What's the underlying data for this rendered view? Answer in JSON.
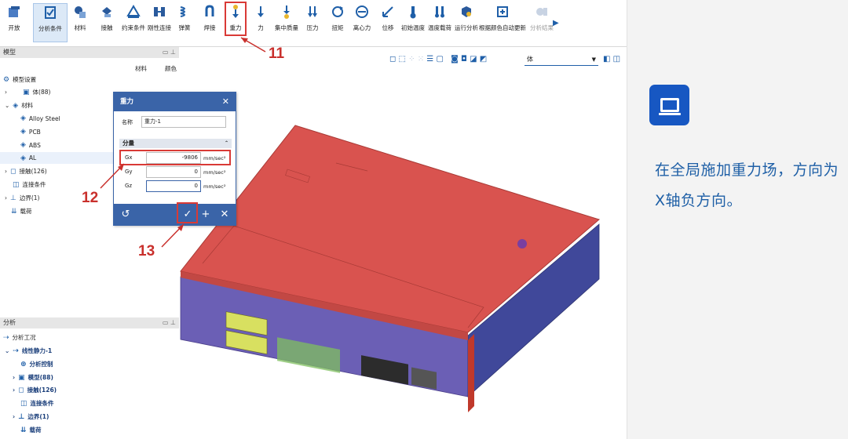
{
  "ribbon": {
    "items": [
      {
        "label": "开放",
        "icon": "open-icon"
      },
      {
        "label": "分析条件",
        "icon": "analysis-conditions-icon"
      },
      {
        "label": "材料",
        "icon": "material-icon"
      },
      {
        "label": "接触",
        "icon": "contact-icon"
      },
      {
        "label": "约束条件",
        "icon": "constraint-icon"
      },
      {
        "label": "刚性连接",
        "icon": "rigid-link-icon"
      },
      {
        "label": "弹簧",
        "icon": "spring-icon"
      },
      {
        "label": "焊接",
        "icon": "weld-icon"
      },
      {
        "label": "重力",
        "icon": "gravity-icon"
      },
      {
        "label": "力",
        "icon": "force-icon"
      },
      {
        "label": "集中质量",
        "icon": "point-mass-icon"
      },
      {
        "label": "压力",
        "icon": "pressure-icon"
      },
      {
        "label": "扭矩",
        "icon": "torque-icon"
      },
      {
        "label": "离心力",
        "icon": "centrifugal-icon"
      },
      {
        "label": "位移",
        "icon": "displacement-icon"
      },
      {
        "label": "初始温度",
        "icon": "initial-temperature-icon"
      },
      {
        "label": "温度载荷",
        "icon": "temperature-load-icon"
      },
      {
        "label": "运行分析",
        "icon": "run-analysis-icon"
      },
      {
        "label": "根据颜色自动更新",
        "icon": "auto-update-color-icon"
      },
      {
        "label": "分析结果",
        "icon": "analysis-results-icon"
      }
    ],
    "selected": "分析条件",
    "highlighted": "重力"
  },
  "callouts": {
    "c11": "11",
    "c12": "12",
    "c13": "13"
  },
  "model_panel": {
    "title": "模型",
    "col_material": "材料",
    "col_color": "颜色",
    "rows": [
      {
        "label": "模型设置"
      },
      {
        "label": "体(88)"
      },
      {
        "label": "材料"
      },
      {
        "label": "Alloy Steel"
      },
      {
        "label": "PCB"
      },
      {
        "label": "ABS"
      },
      {
        "label": "AL"
      },
      {
        "label": "接触(126)"
      },
      {
        "label": "连接条件"
      },
      {
        "label": "边界(1)"
      },
      {
        "label": "载荷"
      }
    ]
  },
  "analysis_panel": {
    "title": "分析",
    "rows": [
      {
        "label": "分析工况"
      },
      {
        "label": "线性静力-1"
      },
      {
        "label": "分析控制"
      },
      {
        "label": "模型(88)"
      },
      {
        "label": "接触(126)"
      },
      {
        "label": "连接条件"
      },
      {
        "label": "边界(1)"
      },
      {
        "label": "载荷"
      }
    ]
  },
  "gravity_dialog": {
    "title": "重力",
    "name_label": "名称",
    "name_value": "重力-1",
    "group_label": "分量",
    "gx_label": "Gx",
    "gx_value": "-9806",
    "gy_label": "Gy",
    "gy_value": "0",
    "gz_label": "Gz",
    "gz_value": "0",
    "unit": "mm/sec²"
  },
  "view_toolbar": {
    "body_select": "体"
  },
  "info_panel": {
    "description": "在全局施加重力场，方向为X轴负方向。"
  },
  "colors": {
    "accent": "#1757c2",
    "dialog_header": "#3a64a8",
    "highlight": "#d93a36",
    "model_top": "#d9534f",
    "model_chassis": "#6b5fb5"
  }
}
